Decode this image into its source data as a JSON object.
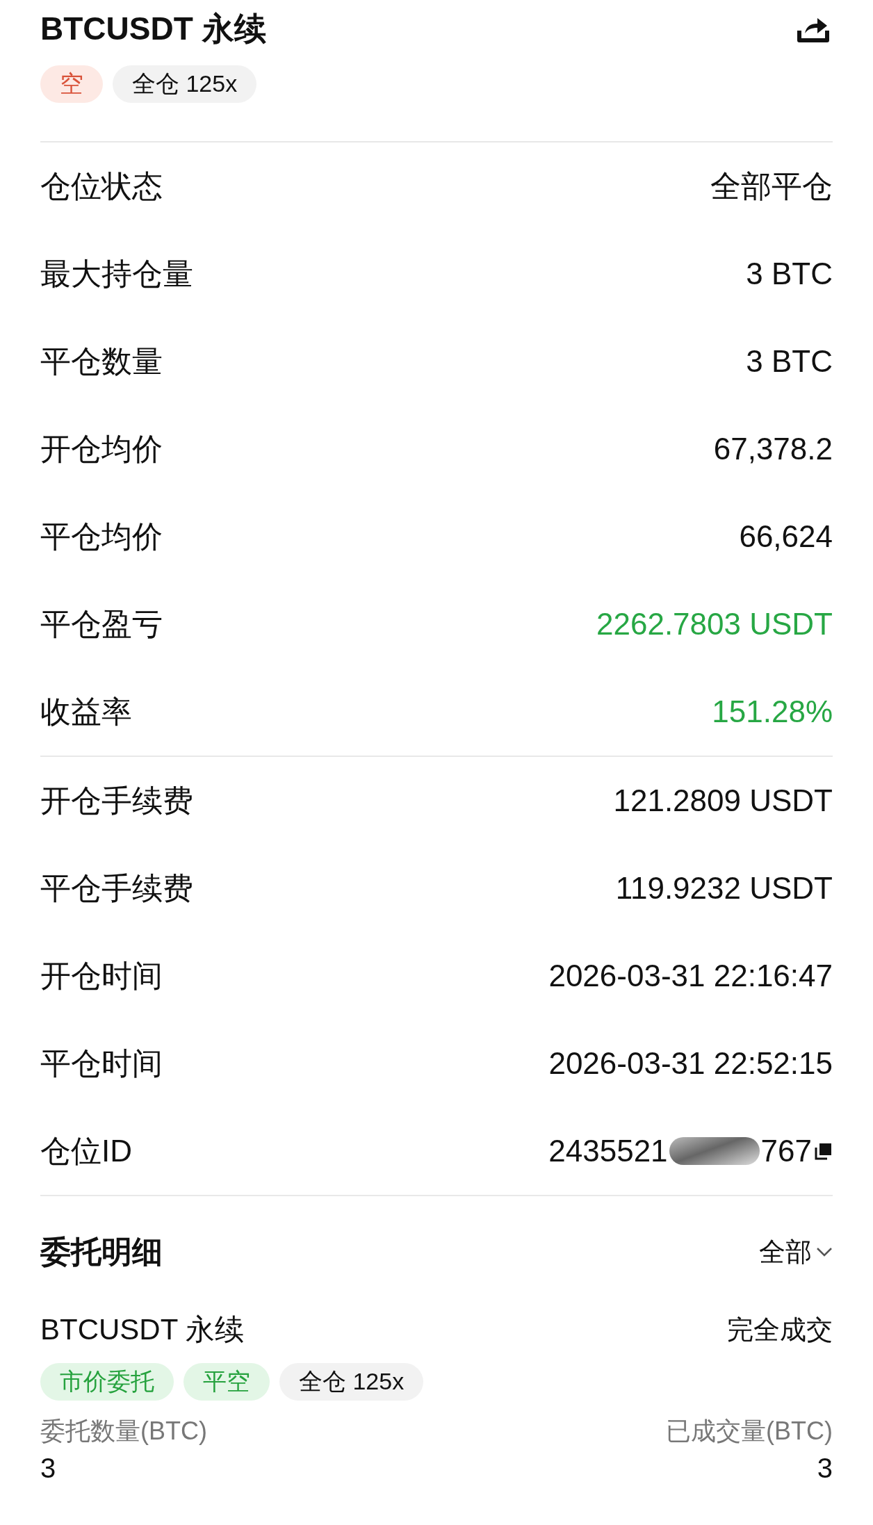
{
  "header": {
    "title": "BTCUSDT 永续",
    "tags": [
      {
        "label": "空",
        "kind": "short"
      },
      {
        "label": "全仓 125x",
        "kind": "neutral"
      }
    ]
  },
  "sections": [
    {
      "rows": [
        {
          "label": "仓位状态",
          "value": "全部平仓",
          "kind": "plain"
        },
        {
          "label": "最大持仓量",
          "value": "3 BTC",
          "kind": "plain"
        },
        {
          "label": "平仓数量",
          "value": "3 BTC",
          "kind": "plain"
        },
        {
          "label": "开仓均价",
          "value": "67,378.2",
          "kind": "plain"
        },
        {
          "label": "平仓均价",
          "value": "66,624",
          "kind": "plain"
        },
        {
          "label": "平仓盈亏",
          "value": "2262.7803 USDT",
          "kind": "profit"
        },
        {
          "label": "收益率",
          "value": "151.28%",
          "kind": "profit"
        }
      ]
    },
    {
      "rows": [
        {
          "label": "开仓手续费",
          "value": "121.2809 USDT",
          "kind": "plain"
        },
        {
          "label": "平仓手续费",
          "value": "119.9232 USDT",
          "kind": "plain"
        },
        {
          "label": "开仓时间",
          "value": "2026-03-31 22:16:47",
          "kind": "plain"
        },
        {
          "label": "平仓时间",
          "value": "2026-03-31 22:52:15",
          "kind": "plain"
        }
      ]
    }
  ],
  "position_id": {
    "label": "仓位ID",
    "value_start": "2435521",
    "value_end": "767"
  },
  "orders": {
    "title": "委托明细",
    "filter": "全部",
    "items": [
      {
        "symbol": "BTCUSDT 永续",
        "status": "完全成交",
        "tags": [
          {
            "label": "市价委托",
            "kind": "green"
          },
          {
            "label": "平空",
            "kind": "green"
          },
          {
            "label": "全仓 125x",
            "kind": "neutral"
          }
        ],
        "fields": [
          {
            "label": "委托数量(BTC)",
            "value": "3"
          },
          {
            "label": "已成交量(BTC)",
            "value": "3"
          }
        ]
      }
    ]
  }
}
